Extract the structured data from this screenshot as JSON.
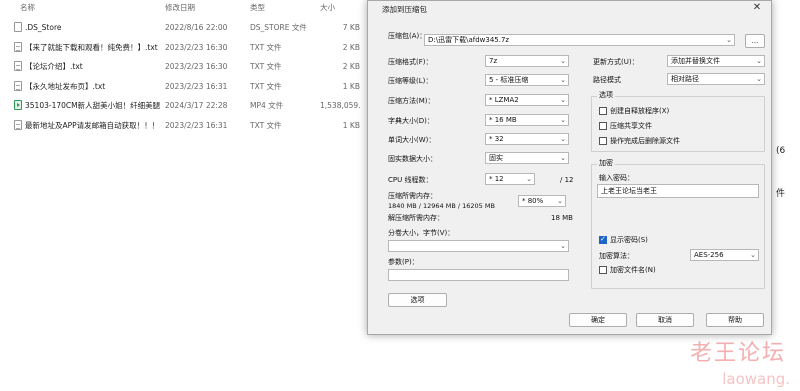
{
  "explorer": {
    "columns": {
      "name": "名称",
      "date": "修改日期",
      "type": "类型",
      "size": "大小"
    },
    "files": [
      {
        "name": ".DS_Store",
        "date": "2022/8/16 22:00",
        "type": "DS_STORE 文件",
        "size": "7 KB",
        "icon": "file-icon"
      },
      {
        "name": "【来了就能下载和观看！纯免费！】.txt",
        "date": "2023/2/23 16:30",
        "type": "TXT 文件",
        "size": "2 KB",
        "icon": "text-file-icon"
      },
      {
        "name": "【论坛介绍】.txt",
        "date": "2023/2/23 16:30",
        "type": "TXT 文件",
        "size": "2 KB",
        "icon": "text-file-icon"
      },
      {
        "name": "【永久地址发布页】.txt",
        "date": "2023/2/23 16:31",
        "type": "TXT 文件",
        "size": "1 KB",
        "icon": "text-file-icon"
      },
      {
        "name": "35103-170CM新人甜美小姐！纤细美腿...",
        "date": "2024/3/17 22:28",
        "type": "MP4 文件",
        "size": "1,538,059...",
        "icon": "video-file-icon"
      },
      {
        "name": "最新地址及APP请发邮箱自动获取！！！...",
        "date": "2023/2/23 16:31",
        "type": "TXT 文件",
        "size": "1 KB",
        "icon": "text-file-icon"
      }
    ],
    "right_fragments": [
      "(6",
      "件"
    ]
  },
  "watermark": {
    "text": "老王论坛",
    "sub": "laowang."
  },
  "dialog": {
    "title": "添加到压缩包",
    "archive": {
      "label": "压缩包(A)：",
      "path": "D:\\迅雷下载\\afdw345.7z",
      "browse_label": "..."
    },
    "left": {
      "format": {
        "label": "压缩格式(F)：",
        "value": "7z"
      },
      "level": {
        "label": "压缩等级(L)：",
        "value": "5 - 标准压缩"
      },
      "method": {
        "label": "压缩方法(M)：",
        "value": "* LZMA2"
      },
      "dict": {
        "label": "字典大小(D)：",
        "value": "* 16 MB"
      },
      "word": {
        "label": "单词大小(W)：",
        "value": "* 32"
      },
      "solid": {
        "label": "固实数据大小：",
        "value": "固实"
      },
      "cpu": {
        "label": "CPU 线程数：",
        "value": "* 12",
        "total": "/ 12"
      },
      "mem_compress": {
        "label": "压缩所需内存：",
        "detail": "1840 MB / 12964 MB / 16205 MB",
        "value": "* 80%"
      },
      "mem_decompress": {
        "label": "解压缩所需内存：",
        "value": "18 MB"
      },
      "split": {
        "label": "分卷大小，字节(V)：",
        "value": ""
      },
      "params": {
        "label": "参数(P)：",
        "value": ""
      },
      "options_btn": "选项"
    },
    "right": {
      "update_mode": {
        "label": "更新方式(U)：",
        "value": "添加并替换文件"
      },
      "path_mode": {
        "label": "路径模式",
        "value": "相对路径"
      },
      "options_group": {
        "title": "选项",
        "items": [
          {
            "label": "创建自释放程序(X)",
            "checked": false
          },
          {
            "label": "压缩共享文件",
            "checked": false
          },
          {
            "label": "操作完成后删除源文件",
            "checked": false
          }
        ]
      },
      "encryption_group": {
        "title": "加密",
        "password_label": "输入密码：",
        "password_value": "上老王论坛当老王",
        "show_password": {
          "label": "显示密码(S)",
          "checked": true
        },
        "method_label": "加密算法：",
        "method_value": "AES-256",
        "encrypt_names": {
          "label": "加密文件名(N)",
          "checked": false
        }
      }
    },
    "buttons": {
      "ok": "确定",
      "cancel": "取消",
      "help": "帮助"
    }
  },
  "colors": {
    "accent": "#1e63c8",
    "dialog_bg": "#f0f0f0",
    "watermark": "#eb6e6e"
  }
}
